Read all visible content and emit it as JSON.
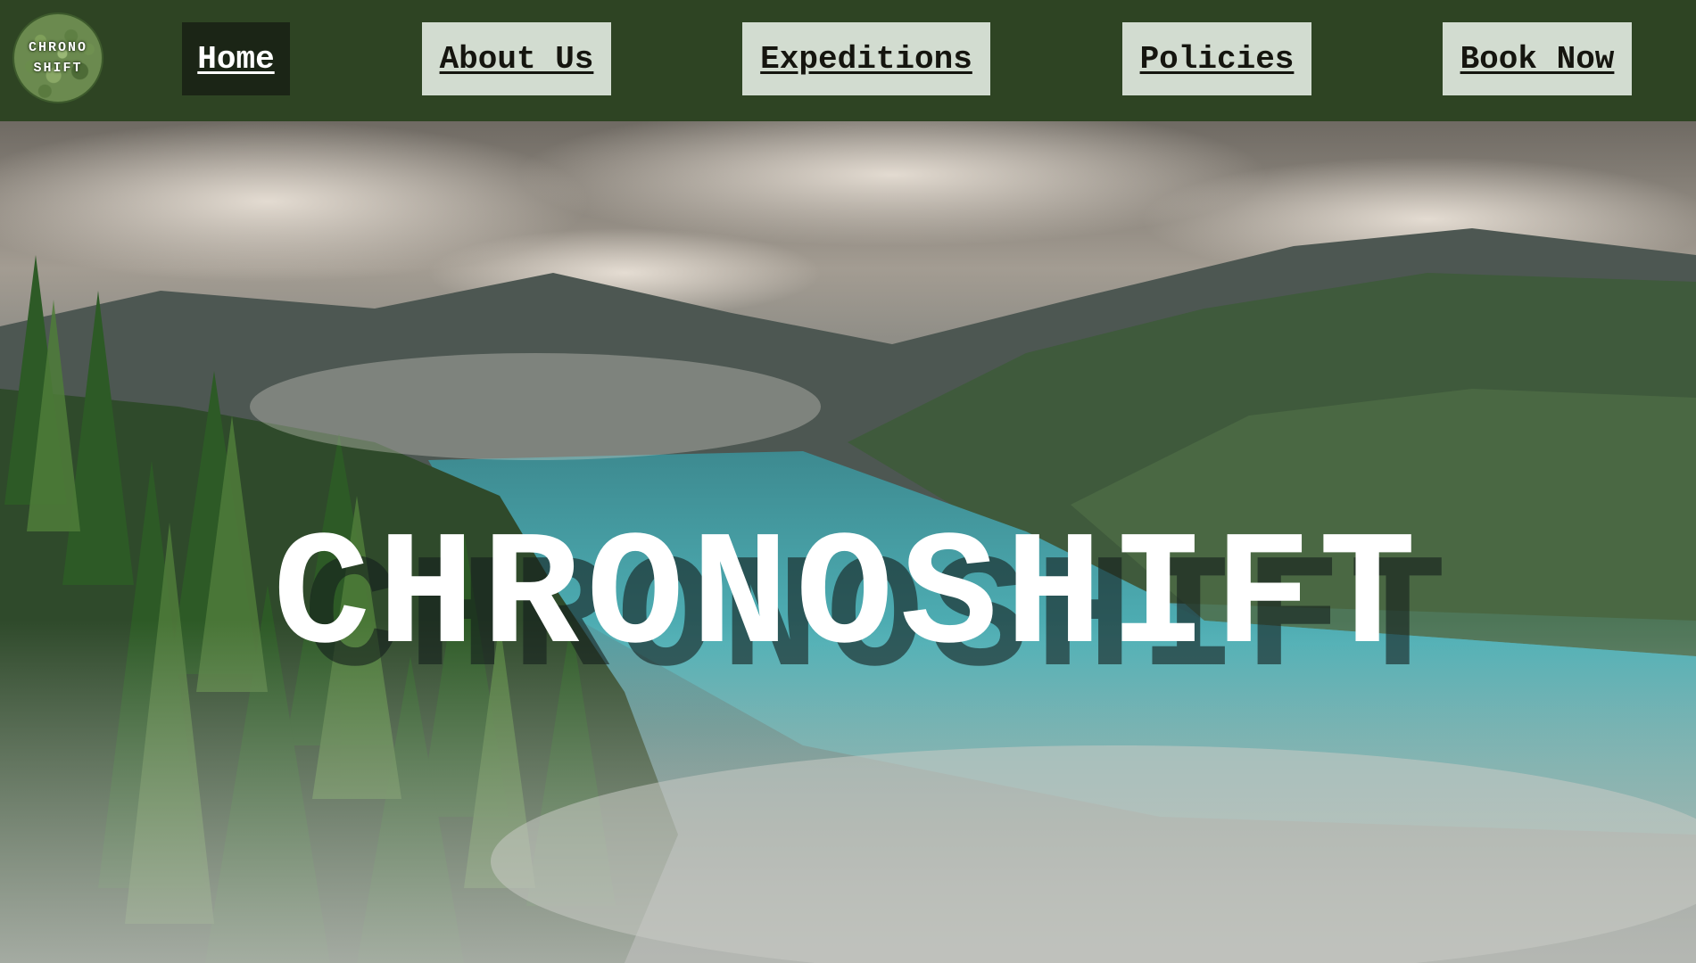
{
  "logo": {
    "line1": "CHRONO",
    "line2": "SHIFT"
  },
  "nav": {
    "items": [
      {
        "label": "Home",
        "active": true
      },
      {
        "label": "About Us",
        "active": false
      },
      {
        "label": "Expeditions",
        "active": false
      },
      {
        "label": "Policies",
        "active": false
      },
      {
        "label": "Book Now",
        "active": false
      }
    ]
  },
  "hero": {
    "title": "CHRONOSHIFT",
    "image_description": "forest-mountain-lake-fog"
  },
  "colors": {
    "nav_background": "#2e4423",
    "nav_button_background": "#d2dcd0",
    "nav_button_active_background": "#1b2516",
    "nav_button_text": "#15150f",
    "hero_title_text": "#ffffff"
  }
}
